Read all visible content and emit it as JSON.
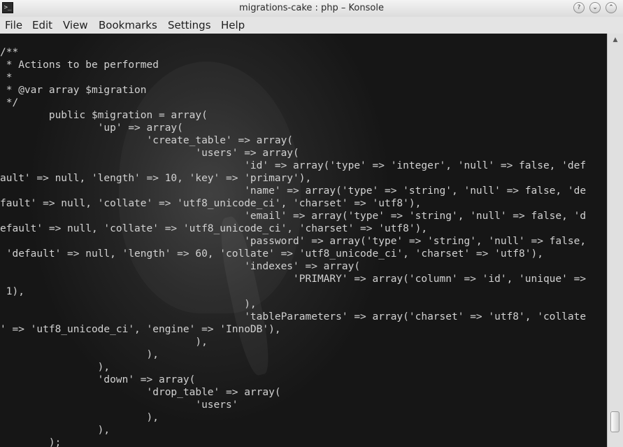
{
  "window": {
    "title": "migrations-cake : php – Konsole",
    "app_icon": ">_",
    "buttons": {
      "help": "?",
      "minimize": "⌄",
      "maximize": "⌃",
      "close": "✕"
    }
  },
  "menu": [
    "File",
    "Edit",
    "View",
    "Bookmarks",
    "Settings",
    "Help"
  ],
  "terminal": {
    "lines": [
      "/**",
      " * Actions to be performed",
      " *",
      " * @var array $migration",
      " */",
      "        public $migration = array(",
      "                'up' => array(",
      "                        'create_table' => array(",
      "                                'users' => array(",
      "                                        'id' => array('type' => 'integer', 'null' => false, 'def",
      "ault' => null, 'length' => 10, 'key' => 'primary'),",
      "                                        'name' => array('type' => 'string', 'null' => false, 'de",
      "fault' => null, 'collate' => 'utf8_unicode_ci', 'charset' => 'utf8'),",
      "                                        'email' => array('type' => 'string', 'null' => false, 'd",
      "efault' => null, 'collate' => 'utf8_unicode_ci', 'charset' => 'utf8'),",
      "                                        'password' => array('type' => 'string', 'null' => false,",
      " 'default' => null, 'length' => 60, 'collate' => 'utf8_unicode_ci', 'charset' => 'utf8'),",
      "                                        'indexes' => array(",
      "                                                'PRIMARY' => array('column' => 'id', 'unique' =>",
      " 1),",
      "                                        ),",
      "                                        'tableParameters' => array('charset' => 'utf8', 'collate",
      "' => 'utf8_unicode_ci', 'engine' => 'InnoDB'),",
      "                                ),",
      "                        ),",
      "                ),",
      "                'down' => array(",
      "                        'drop_table' => array(",
      "                                'users'",
      "                        ),",
      "                ),",
      "        );"
    ]
  },
  "colors": {
    "terminal_bg": "#1b1b1b",
    "terminal_fg": "#d2d2d2",
    "chrome": "#e4e4e4"
  },
  "icons": {
    "app": "konsole-terminal-icon",
    "help": "question-icon",
    "minimize": "chevron-down-icon",
    "maximize": "chevron-up-icon",
    "close": "close-icon",
    "scroll_up": "arrow-up-icon"
  },
  "scrollbar": {
    "up_arrow": "▲",
    "position_fraction": 0.95
  }
}
